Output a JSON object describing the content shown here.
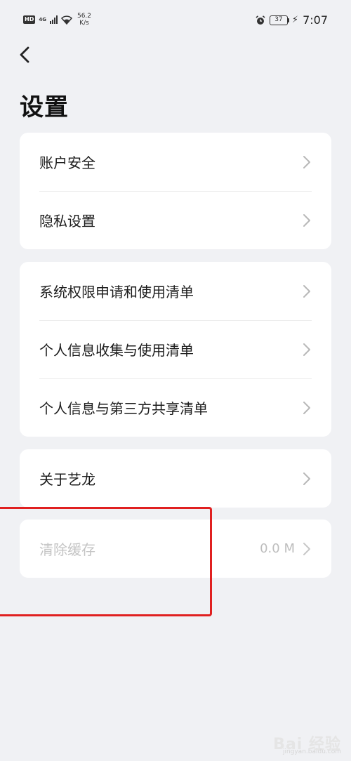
{
  "status_bar": {
    "hd": "HD",
    "network": "4G",
    "speed_value": "56.2",
    "speed_unit": "K/s",
    "battery": "37",
    "time": "7:07"
  },
  "header": {
    "title": "设置"
  },
  "groups": [
    {
      "items": [
        {
          "label": "账户安全"
        },
        {
          "label": "隐私设置"
        }
      ]
    },
    {
      "items": [
        {
          "label": "系统权限申请和使用清单"
        },
        {
          "label": "个人信息收集与使用清单"
        },
        {
          "label": "个人信息与第三方共享清单"
        }
      ]
    },
    {
      "items": [
        {
          "label": "关于艺龙"
        }
      ]
    },
    {
      "items": [
        {
          "label": "清除缓存",
          "value": "0.0 M"
        }
      ]
    }
  ],
  "watermark": {
    "text": "Bai 经验",
    "sub": "jingyan.baidu.com"
  },
  "colors": {
    "background": "#f0f1f4",
    "card": "#ffffff",
    "annotation": "#e02020"
  }
}
